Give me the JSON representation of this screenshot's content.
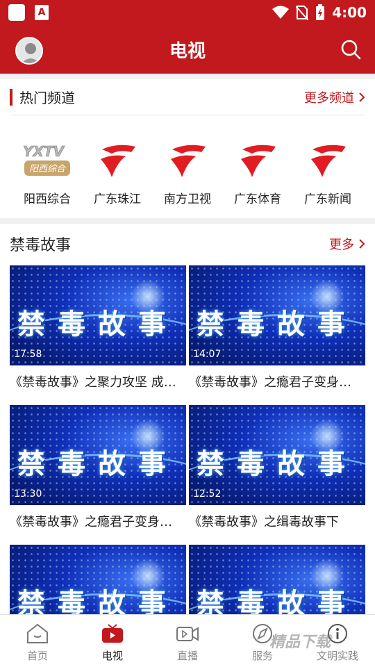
{
  "status_bar": {
    "time": "4:00",
    "app_icon_letter": "A"
  },
  "header": {
    "title": "电视"
  },
  "hot_channels": {
    "title": "热门频道",
    "more_label": "更多频道",
    "channels": [
      {
        "name": "阳西综合",
        "logo_text": "YXTV",
        "logo_sub": "阳西综合"
      },
      {
        "name": "广东珠江"
      },
      {
        "name": "南方卫视"
      },
      {
        "name": "广东体育"
      },
      {
        "name": "广东新闻"
      }
    ]
  },
  "stories": {
    "title": "禁毒故事",
    "more_label": "更多",
    "thumb_text": "禁毒故事",
    "items": [
      {
        "duration": "17:58",
        "title": "《禁毒故事》之聚力攻坚 成…"
      },
      {
        "duration": "14:07",
        "title": "《禁毒故事》之瘾君子变身…"
      },
      {
        "duration": "13:30",
        "title": "《禁毒故事》之瘾君子变身…"
      },
      {
        "duration": "12:52",
        "title": "《禁毒故事》之缉毒故事下"
      },
      {
        "duration": "",
        "title": ""
      },
      {
        "duration": "",
        "title": ""
      }
    ]
  },
  "nav": {
    "items": [
      {
        "label": "首页"
      },
      {
        "label": "电视"
      },
      {
        "label": "直播"
      },
      {
        "label": "服务"
      },
      {
        "label": "文明实践"
      }
    ]
  },
  "watermark": "精品下载",
  "colors": {
    "brand": "#c1191d"
  }
}
